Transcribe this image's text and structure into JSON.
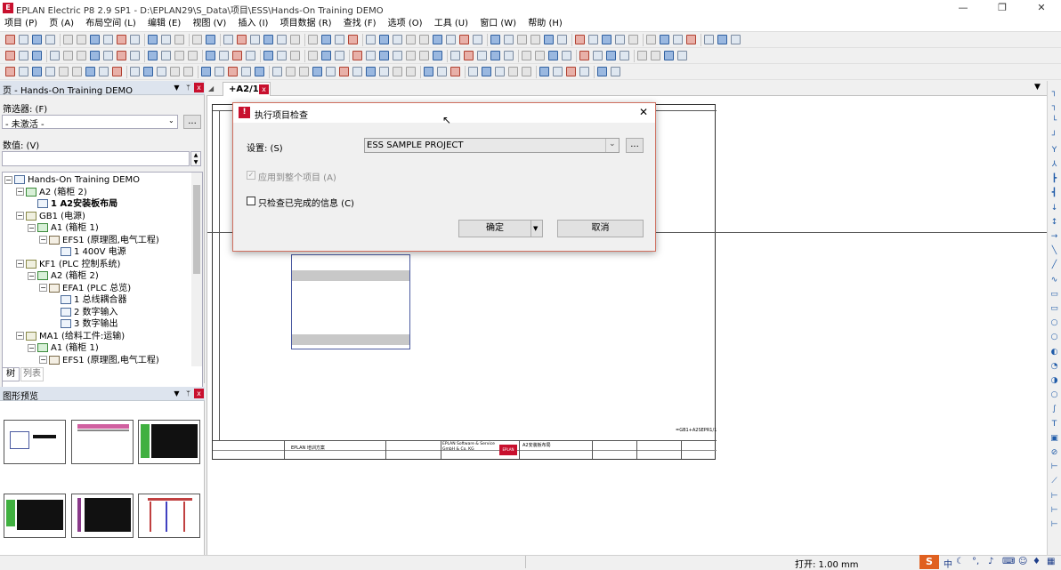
{
  "window": {
    "title": "EPLAN Electric P8 2.9 SP1 - D:\\EPLAN29\\S_Data\\项目\\ESS\\Hands-On Training DEMO",
    "minimize_glyph": "—",
    "maximize_glyph": "❐",
    "close_glyph": "✕"
  },
  "menu": [
    "项目 (P)",
    "页 (A)",
    "布局空间 (L)",
    "编辑 (E)",
    "视图 (V)",
    "插入 (I)",
    "项目数据 (R)",
    "查找 (F)",
    "选项 (O)",
    "工具 (U)",
    "窗口 (W)",
    "帮助 (H)"
  ],
  "page_panel": {
    "title": "页 - Hands-On Training DEMO",
    "filter_label": "筛选器: (F)",
    "filter_value": "- 未激活 -",
    "filter_more": "...",
    "value_label": "数值: (V)",
    "value_text": "",
    "tabs": [
      "树",
      "列表"
    ],
    "tree": [
      {
        "text": "Hands-On Training DEMO",
        "level": 0,
        "icon": "project",
        "exp": "−",
        "bold": false
      },
      {
        "text": "A2 (箱柜 2)",
        "level": 1,
        "icon": "plus",
        "exp": "−",
        "bold": false
      },
      {
        "text": "1 A2安装板布局",
        "level": 2,
        "icon": "page",
        "exp": "",
        "bold": true
      },
      {
        "text": "GB1 (电源)",
        "level": 1,
        "icon": "plc",
        "exp": "−",
        "bold": false
      },
      {
        "text": "A1 (箱柜 1)",
        "level": 2,
        "icon": "plus",
        "exp": "−",
        "bold": false
      },
      {
        "text": "EFS1 (原理图,电气工程)",
        "level": 3,
        "icon": "doc",
        "exp": "−",
        "bold": false
      },
      {
        "text": "1 400V 电源",
        "level": 4,
        "icon": "page",
        "exp": "",
        "bold": false
      },
      {
        "text": "KF1 (PLC 控制系统)",
        "level": 1,
        "icon": "plc",
        "exp": "−",
        "bold": false
      },
      {
        "text": "A2 (箱柜 2)",
        "level": 2,
        "icon": "plus",
        "exp": "−",
        "bold": false
      },
      {
        "text": "EFA1 (PLC 总览)",
        "level": 3,
        "icon": "doc",
        "exp": "−",
        "bold": false
      },
      {
        "text": "1 总线耦合器",
        "level": 4,
        "icon": "page",
        "exp": "",
        "bold": false
      },
      {
        "text": "2 数字输入",
        "level": 4,
        "icon": "page",
        "exp": "",
        "bold": false
      },
      {
        "text": "3 数字输出",
        "level": 4,
        "icon": "page",
        "exp": "",
        "bold": false
      },
      {
        "text": "MA1 (给料工件:运输)",
        "level": 1,
        "icon": "plc",
        "exp": "−",
        "bold": false
      },
      {
        "text": "A1 (箱柜 1)",
        "level": 2,
        "icon": "plus",
        "exp": "−",
        "bold": false
      },
      {
        "text": "EFS1 (原理图,电气工程)",
        "level": 3,
        "icon": "doc",
        "exp": "−",
        "bold": false
      }
    ]
  },
  "preview_panel": {
    "title": "图形预览"
  },
  "doc_tab": {
    "label": "+A2/1",
    "close": "x"
  },
  "drawing": {
    "ref_text": "=GB1+A2SEPR1/1",
    "title_block": {
      "cell1": "EPLAN 培训方案",
      "cell2": "EPLAN Software & Service GmbH & Co. KG",
      "cell3": "A2安装板布局",
      "logo": "EPLAN"
    }
  },
  "dialog": {
    "title": "执行项目检查",
    "settings_label": "设置: (S)",
    "settings_value": "ESS SAMPLE PROJECT",
    "settings_more": "...",
    "apply_label": "应用到整个项目 (A)",
    "apply_checked": true,
    "only_label": "只检查已完成的信息 (C)",
    "only_checked": false,
    "ok_label": "确定",
    "cancel_label": "取消",
    "close_glyph": "✕"
  },
  "status": {
    "snap": "打开: 1.00 mm",
    "ime": "中"
  }
}
